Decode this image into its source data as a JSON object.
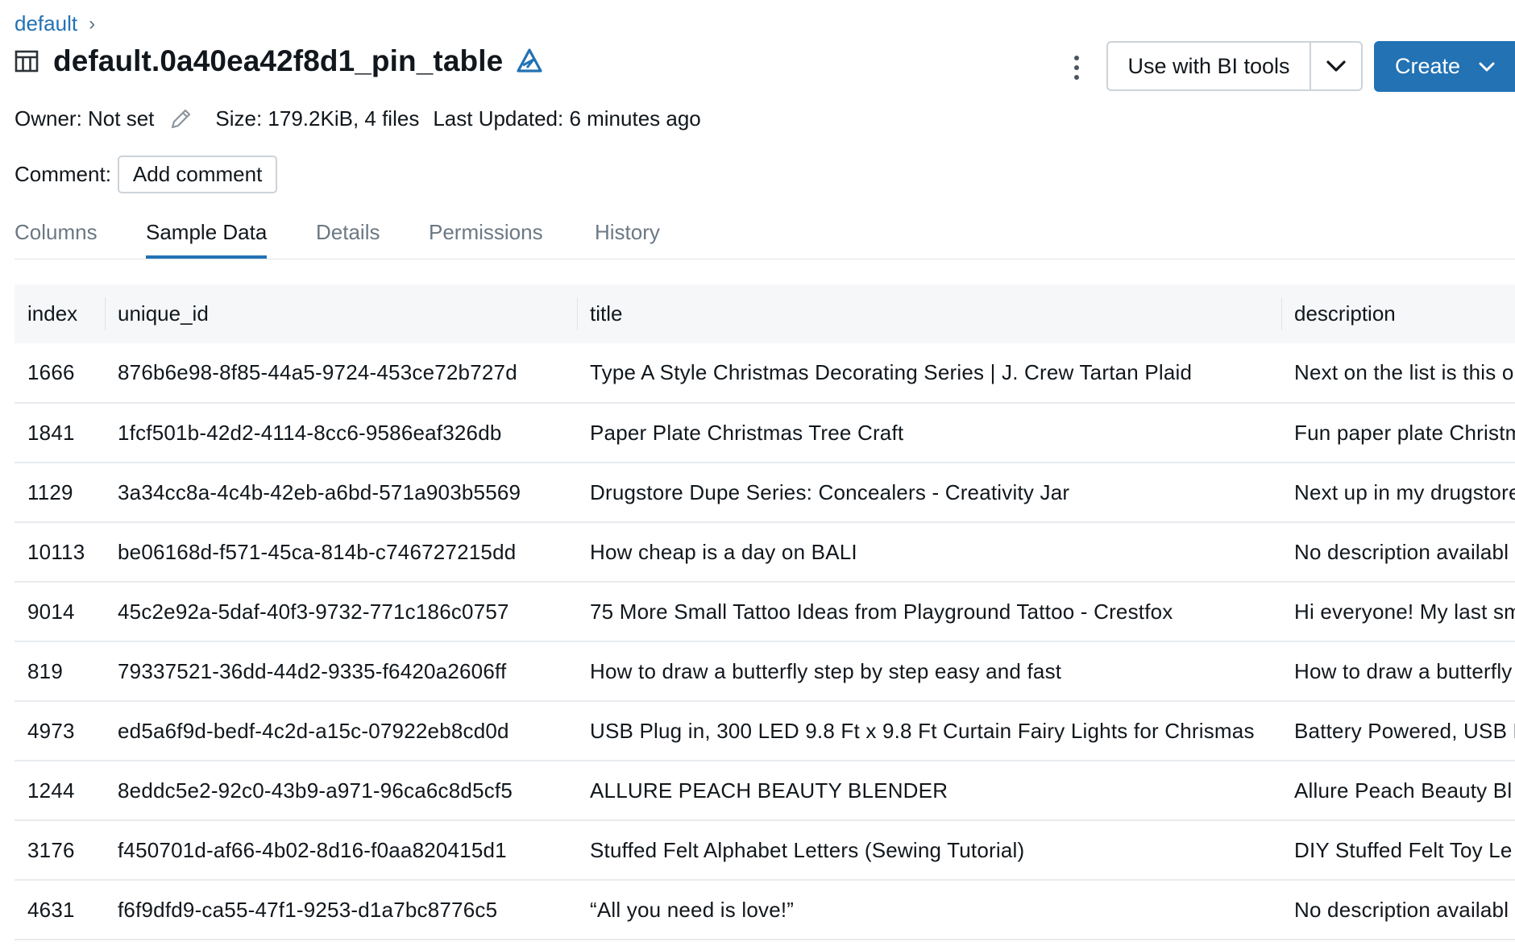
{
  "breadcrumb": {
    "root": "default",
    "separator": "›"
  },
  "header": {
    "title": "default.0a40ea42f8d1_pin_table",
    "table_icon": "table-icon",
    "format_icon": "delta-icon"
  },
  "actions": {
    "more_icon": "kebab-menu-icon",
    "bi_tools_label": "Use with BI tools",
    "bi_caret_icon": "chevron-down-icon",
    "create_label": "Create",
    "create_caret_icon": "chevron-down-icon"
  },
  "meta": {
    "owner": "Owner: Not set",
    "size": "Size: 179.2KiB, 4 files",
    "last_updated": "Last Updated: 6 minutes ago"
  },
  "comment": {
    "label": "Comment:",
    "button": "Add comment"
  },
  "tabs": [
    {
      "label": "Columns",
      "active": false
    },
    {
      "label": "Sample Data",
      "active": true
    },
    {
      "label": "Details",
      "active": false
    },
    {
      "label": "Permissions",
      "active": false
    },
    {
      "label": "History",
      "active": false
    }
  ],
  "table": {
    "columns": [
      "index",
      "unique_id",
      "title",
      "description"
    ],
    "rows": [
      [
        "1666",
        "876b6e98-8f85-44a5-9724-453ce72b727d",
        "Type A Style Christmas Decorating Series | J. Crew Tartan Plaid",
        "Next on the list is this o"
      ],
      [
        "1841",
        "1fcf501b-42d2-4114-8cc6-9586eaf326db",
        "Paper Plate Christmas Tree Craft",
        "Fun paper plate Christm"
      ],
      [
        "1129",
        "3a34cc8a-4c4b-42eb-a6bd-571a903b5569",
        "Drugstore Dupe Series: Concealers - Creativity Jar",
        "Next up in my drugstore"
      ],
      [
        "10113",
        "be06168d-f571-45ca-814b-c746727215dd",
        "How cheap is a day on BALI",
        "No description availabl"
      ],
      [
        "9014",
        "45c2e92a-5daf-40f3-9732-771c186c0757",
        "75 More Small Tattoo Ideas from Playground Tattoo - Crestfox",
        "Hi everyone! My last sm"
      ],
      [
        "819",
        "79337521-36dd-44d2-9335-f6420a2606ff",
        "How to draw a butterfly step by step easy and fast",
        "How to draw a butterfly"
      ],
      [
        "4973",
        "ed5a6f9d-bedf-4c2d-a15c-07922eb8cd0d",
        "USB Plug in, 300 LED 9.8 Ft x 9.8 Ft Curtain Fairy Lights for Chrismas",
        "Battery Powered, USB P"
      ],
      [
        "1244",
        "8eddc5e2-92c0-43b9-a971-96ca6c8d5cf5",
        "ALLURE PEACH BEAUTY BLENDER",
        "Allure Peach Beauty Bl"
      ],
      [
        "3176",
        "f450701d-af66-4b02-8d16-f0aa820415d1",
        "Stuffed Felt Alphabet Letters (Sewing Tutorial)",
        "DIY Stuffed Felt Toy Le"
      ],
      [
        "4631",
        "f6f9dfd9-ca55-47f1-9253-d1a7bc8776c5",
        "“All you need is love!”",
        "No description availabl"
      ]
    ]
  },
  "colors": {
    "accent": "#2272b4",
    "text": "#11171c",
    "muted_tab": "#6b7884",
    "header_bg": "#f6f7f9",
    "border": "#cdd3d9"
  }
}
